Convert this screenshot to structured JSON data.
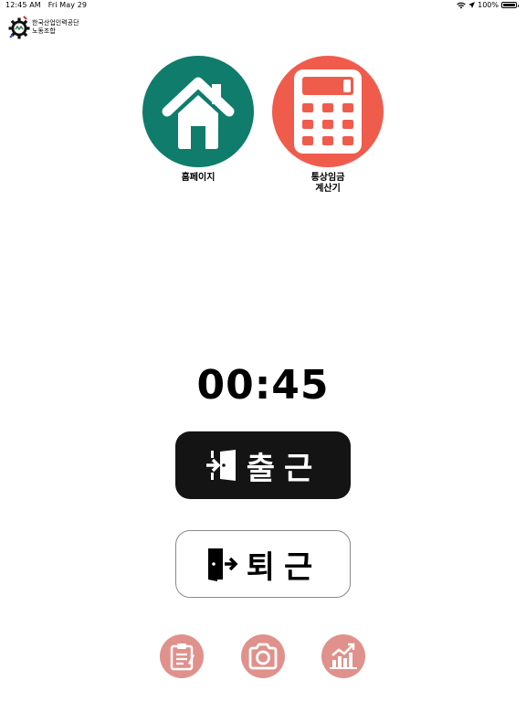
{
  "status_bar": {
    "time": "12:45 AM",
    "date": "Fri May 29",
    "battery": "100%",
    "battery_level": 1.0
  },
  "logo": {
    "text": "한국산업인력공단\n노동조합"
  },
  "apps": [
    {
      "label": "홈페이지",
      "icon": "home-icon",
      "color": "#0f7c6c"
    },
    {
      "label": "통상임금\n계산기",
      "icon": "calculator-icon",
      "color": "#f05c4c"
    }
  ],
  "timer": "00:45",
  "buttons": {
    "clock_in": "출근",
    "clock_out": "퇴근"
  },
  "bottom_icons": [
    {
      "icon": "clipboard-icon"
    },
    {
      "icon": "camera-icon"
    },
    {
      "icon": "chart-icon"
    }
  ],
  "colors": {
    "bottom_icon_bg": "#e0918b",
    "clock_in_bg": "#141414"
  }
}
